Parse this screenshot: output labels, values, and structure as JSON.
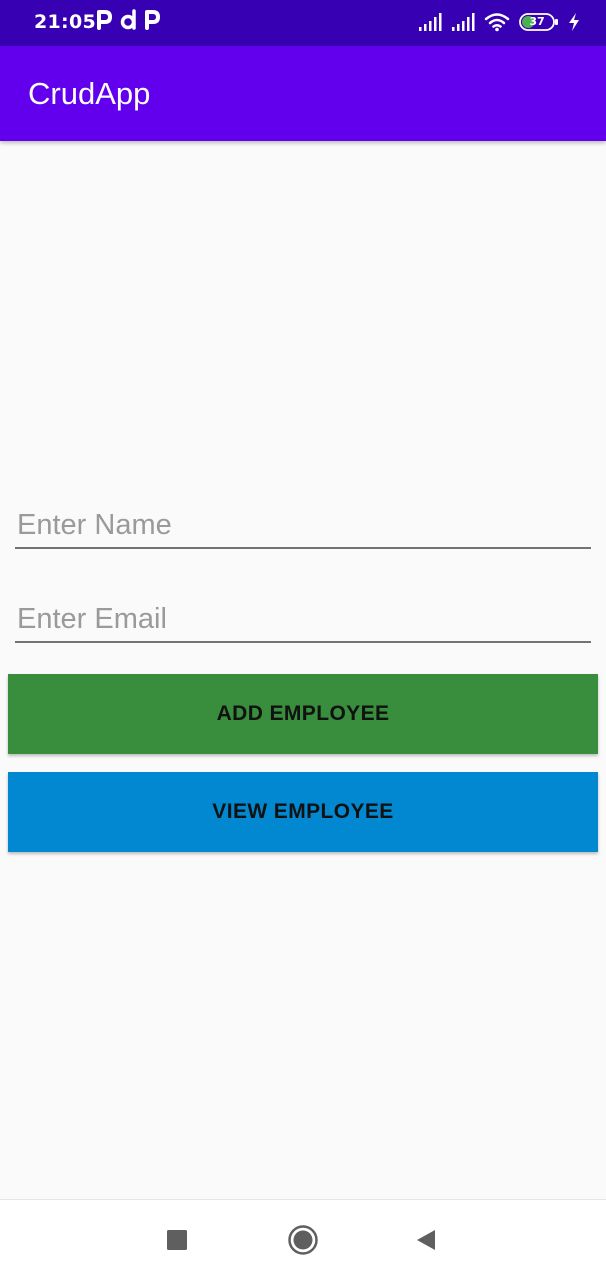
{
  "status_bar": {
    "time": "21:05",
    "notifications": [
      "p-icon",
      "d-icon",
      "p-icon"
    ],
    "battery_level": "37",
    "colors": {
      "background": "#3700b3"
    }
  },
  "app_bar": {
    "title": "CrudApp",
    "colors": {
      "background": "#6200ee"
    }
  },
  "form": {
    "name_placeholder": "Enter Name",
    "name_value": "",
    "email_placeholder": "Enter Email",
    "email_value": ""
  },
  "buttons": {
    "add_label": "ADD EMPLOYEE",
    "add_color": "#388e3c",
    "view_label": "VIEW EMPLOYEE",
    "view_color": "#0288d1"
  },
  "nav_bar": {
    "icons": [
      "recent-apps-icon",
      "home-icon",
      "back-icon"
    ]
  }
}
